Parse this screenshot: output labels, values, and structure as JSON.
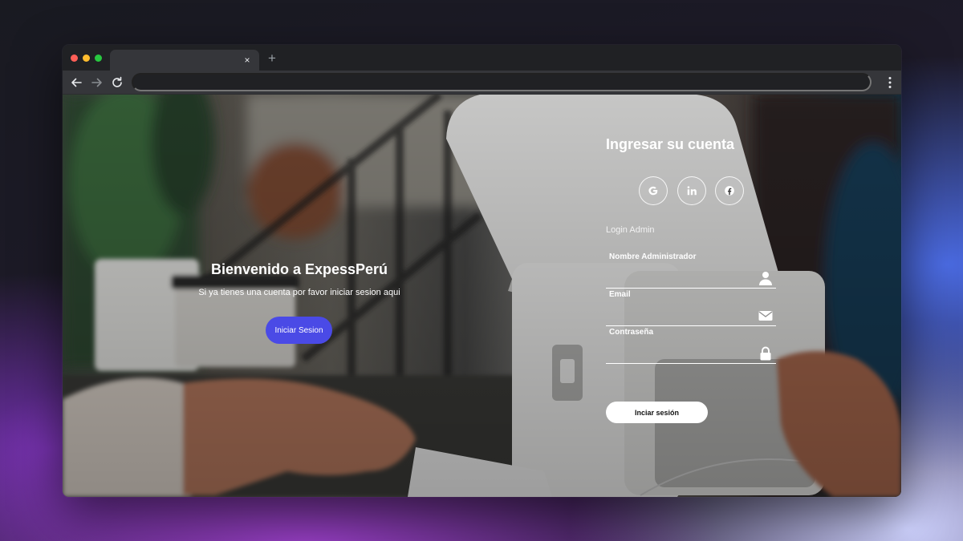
{
  "browser": {
    "tab": {
      "title": "",
      "close_glyph": "×"
    },
    "new_tab_glyph": "+",
    "omnibox": {
      "value": ""
    }
  },
  "welcome": {
    "title": "Bienvenido a ExpessPerú",
    "subtitle": "Si ya tienes una cuenta por favor iniciar sesion aqui",
    "button": "Iniciar Sesion"
  },
  "login": {
    "title": "Ingresar su cuenta",
    "social": [
      "google-icon",
      "linkedin-icon",
      "facebook-icon"
    ],
    "section_label": "Login Admin",
    "fields": {
      "name": {
        "label": "Nombre Administrador",
        "value": "",
        "icon": "user-icon"
      },
      "email": {
        "label": "Email",
        "value": "",
        "icon": "envelope-icon"
      },
      "password": {
        "label": "Contraseña",
        "value": "",
        "icon": "lock-icon"
      }
    },
    "submit": "Inciar sesión"
  },
  "colors": {
    "primary_button": "#4a4ae6",
    "submit_button": "#ffffff",
    "text": "#ffffff"
  }
}
